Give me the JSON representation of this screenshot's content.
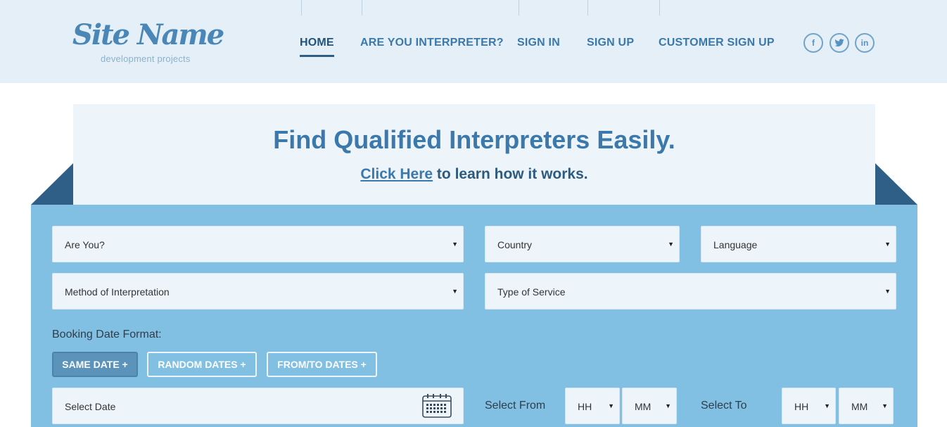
{
  "logo": {
    "name": "Site Name",
    "tagline": "development projects"
  },
  "nav": {
    "items": [
      {
        "label": "HOME",
        "active": true
      },
      {
        "label": "ARE YOU INTERPRETER?"
      },
      {
        "label": "SIGN IN"
      },
      {
        "label": "SIGN UP"
      },
      {
        "label": "CUSTOMER SIGN UP"
      }
    ]
  },
  "social": {
    "facebook": "f",
    "twitter": "t",
    "linkedin": "in"
  },
  "banner": {
    "title": "Find Qualified Interpreters Easily.",
    "link_text": "Click Here",
    "sub_text": " to learn how it works."
  },
  "form": {
    "are_you": "Are You?",
    "country": "Country",
    "language": "Language",
    "method": "Method of Interpretation",
    "service": "Type of Service",
    "booking_label": "Booking Date Format:",
    "buttons": [
      "SAME DATE +",
      "RANDOM DATES +",
      "FROM/TO DATES +"
    ],
    "select_date": "Select Date",
    "select_from": "Select From",
    "select_to": "Select To",
    "hh": "HH",
    "mm": "MM",
    "arrow": "▼"
  },
  "colors": {
    "header_bg": "#e4eff7",
    "brand": "#3b78ab",
    "form_bg": "#81bfe3",
    "field_bg": "#edf5fa",
    "dark_accent": "#2f5f86"
  }
}
